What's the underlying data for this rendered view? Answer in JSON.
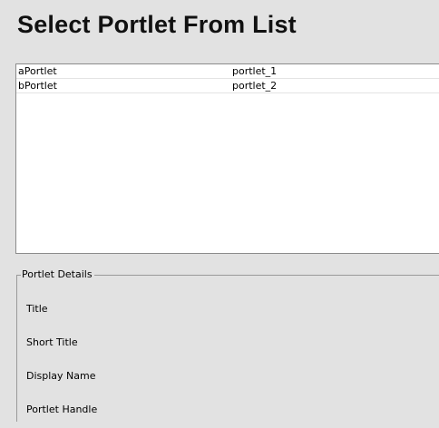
{
  "page": {
    "title": "Select Portlet From List"
  },
  "portlet_list": {
    "rows": [
      {
        "name": "aPortlet",
        "id": "portlet_1"
      },
      {
        "name": "bPortlet",
        "id": "portlet_2"
      }
    ]
  },
  "details": {
    "legend": "Portlet Details",
    "fields": {
      "title": "Title",
      "short_title": "Short Title",
      "display_name": "Display Name",
      "portlet_handle": "Portlet Handle"
    }
  }
}
